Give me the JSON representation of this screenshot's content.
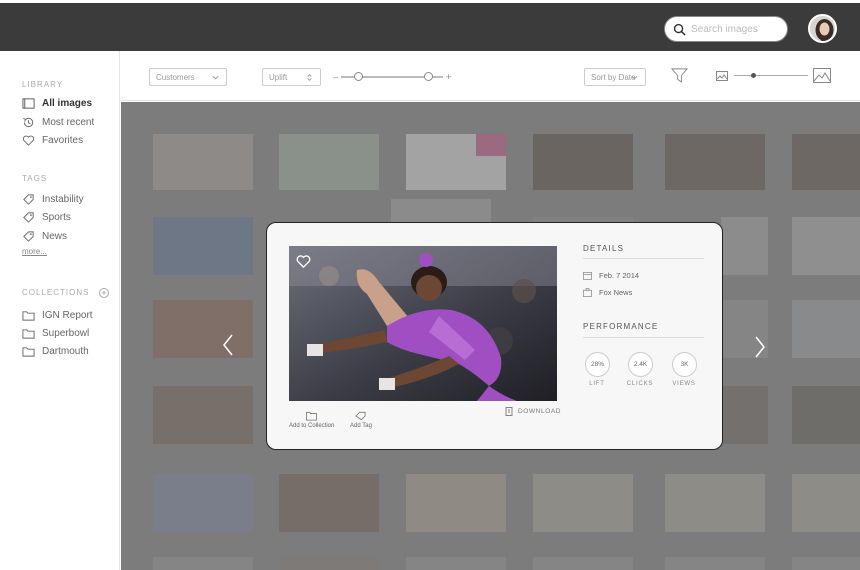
{
  "header": {
    "search": {
      "placeholder": "Search images",
      "icon": "search-icon"
    }
  },
  "sidebar": {
    "library_title": "LIBRARY",
    "library": [
      {
        "label": "All images",
        "icon": "image-stack-icon",
        "active": true
      },
      {
        "label": "Most recent",
        "icon": "history-icon"
      },
      {
        "label": "Favorites",
        "icon": "heart-icon"
      }
    ],
    "tags_title": "TAGS",
    "tags": [
      {
        "label": "Instability",
        "icon": "tag-icon"
      },
      {
        "label": "Sports",
        "icon": "tag-icon"
      },
      {
        "label": "News",
        "icon": "tag-icon"
      }
    ],
    "more_label": "more...",
    "collections_title": "COLLECTIONS",
    "collections": [
      {
        "label": "IGN Report",
        "icon": "folder-icon"
      },
      {
        "label": "Superbowl",
        "icon": "folder-icon"
      },
      {
        "label": "Dartmouth",
        "icon": "folder-icon"
      }
    ]
  },
  "toolbar": {
    "customers_select": "Customers",
    "uplift_select": "Uplift",
    "range_min_symbol": "–",
    "range_max_symbol": "+",
    "range_low_fraction": 0.17,
    "range_high_fraction": 0.86,
    "sort_select": "Sort by Date",
    "thumbnail_size_fraction": 0.27
  },
  "modal": {
    "actions": {
      "add_to_collection": "Add to Collection",
      "add_tag": "Add Tag",
      "download": "DOWNLOAD"
    },
    "details": {
      "title": "DETAILS",
      "date": "Feb. 7 2014",
      "source": "Fox News"
    },
    "performance": {
      "title": "PERFORMANCE",
      "stats": [
        {
          "value": "28%",
          "label": "LIFT"
        },
        {
          "value": "2.4K",
          "label": "CLICKS"
        },
        {
          "value": "3K",
          "label": "VIEWS"
        }
      ]
    }
  },
  "colors": {
    "topbar": "#3b3b3b",
    "overlay": "#7c7c7c",
    "leotard": "#a04fc2",
    "accent_pink": "#c9508f"
  }
}
